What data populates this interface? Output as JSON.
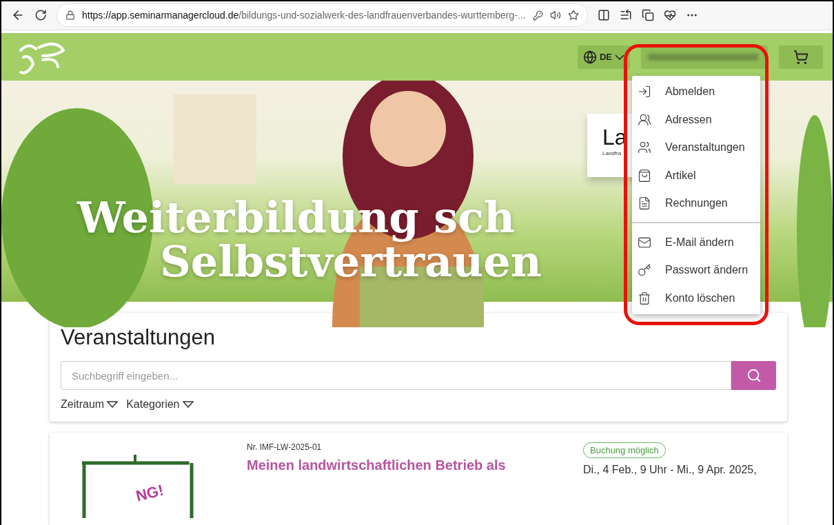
{
  "browser": {
    "url_host": "https://app.seminarmanagercloud.de",
    "url_path": "/bildungs-und-sozialwerk-des-landfrauenverbandes-wurttemberg-..."
  },
  "header": {
    "language": "DE"
  },
  "hero": {
    "headline": [
      "Weiterbildung sch",
      "Selbstvertrauen"
    ],
    "sign": {
      "title": "La",
      "subtitle": "Landfra"
    }
  },
  "user_menu": {
    "groups": [
      [
        {
          "kind": "logout",
          "label": "Abmelden"
        },
        {
          "kind": "addresses",
          "label": "Adressen"
        },
        {
          "kind": "events",
          "label": "Veranstaltungen"
        },
        {
          "kind": "articles",
          "label": "Artikel"
        },
        {
          "kind": "invoices",
          "label": "Rechnungen"
        }
      ],
      [
        {
          "kind": "email",
          "label": "E-Mail ändern"
        },
        {
          "kind": "password",
          "label": "Passwort ändern"
        },
        {
          "kind": "delete",
          "label": "Konto löschen"
        }
      ]
    ]
  },
  "events": {
    "title": "Veranstaltungen",
    "search": {
      "placeholder": "Suchbegriff eingeben..."
    },
    "filters": [
      "Zeitraum",
      "Kategorien"
    ],
    "items": [
      {
        "number": "Nr. IMF-LW-2025-01",
        "title": "Meinen landwirtschaftlichen Betrieb als",
        "status": "Buchung möglich",
        "date": "Di., 4 Feb., 9 Uhr - Mi., 9 Apr. 2025,",
        "image_text": "NG!"
      }
    ]
  }
}
